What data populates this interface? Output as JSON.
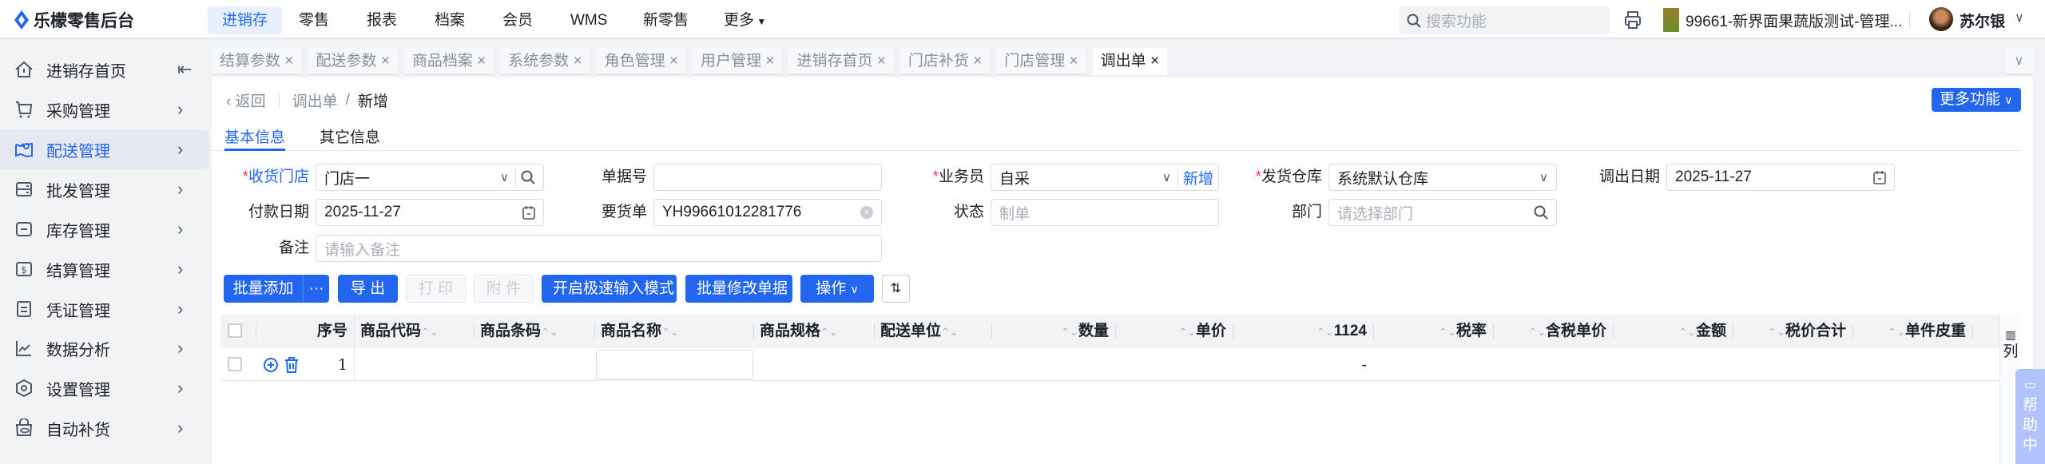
{
  "app": {
    "title": "乐檬零售后台"
  },
  "topnav": {
    "items": [
      "进销存",
      "零售",
      "报表",
      "档案",
      "会员",
      "WMS",
      "新零售",
      "更多"
    ],
    "active": "进销存"
  },
  "header": {
    "search_placeholder": "搜索功能",
    "store": "99661-新界面果蔬版测试-管理...",
    "user": "苏尔银"
  },
  "sidebar": {
    "items": [
      {
        "label": "进销存首页",
        "icon": "home-icon"
      },
      {
        "label": "采购管理",
        "icon": "cart-icon"
      },
      {
        "label": "配送管理",
        "icon": "map-icon"
      },
      {
        "label": "批发管理",
        "icon": "server-icon"
      },
      {
        "label": "库存管理",
        "icon": "inbox-icon"
      },
      {
        "label": "结算管理",
        "icon": "dollar-icon"
      },
      {
        "label": "凭证管理",
        "icon": "document-icon"
      },
      {
        "label": "数据分析",
        "icon": "chart-icon"
      },
      {
        "label": "设置管理",
        "icon": "settings-icon"
      },
      {
        "label": "自动补货",
        "icon": "bag-icon"
      }
    ]
  },
  "tabs": [
    "结算参数",
    "配送参数",
    "商品档案",
    "系统参数",
    "角色管理",
    "用户管理",
    "进销存首页",
    "门店补货",
    "门店管理",
    "调出单"
  ],
  "breadcrumb": {
    "back": "返回",
    "parent": "调出单",
    "sep": "/",
    "current": "新增"
  },
  "more_functions": "更多功能",
  "subtabs": [
    "基本信息",
    "其它信息"
  ],
  "form": {
    "receive_store": {
      "label": "收货门店",
      "value": "门店一"
    },
    "doc_no": {
      "label": "单据号",
      "value": ""
    },
    "salesman": {
      "label": "业务员",
      "value": "自采",
      "link": "新增"
    },
    "warehouse": {
      "label": "发货仓库",
      "value": "系统默认仓库"
    },
    "out_date": {
      "label": "调出日期",
      "value": "2025-11-27"
    },
    "pay_date": {
      "label": "付款日期",
      "value": "2025-11-27"
    },
    "request_no": {
      "label": "要货单",
      "value": "YH99661012281776"
    },
    "status": {
      "label": "状态",
      "value": "制单"
    },
    "department": {
      "label": "部门",
      "placeholder": "请选择部门"
    },
    "remark": {
      "label": "备注",
      "placeholder": "请输入备注"
    }
  },
  "toolbar": {
    "batch_add": "批量添加",
    "more": "···",
    "export": "导 出",
    "print": "打 印",
    "attach": "附 件",
    "fast_input": "开启极速输入模式",
    "batch_edit": "批量修改单据",
    "ops": "操作"
  },
  "table": {
    "columns": [
      "序号",
      "商品代码",
      "商品条码",
      "商品名称",
      "商品规格",
      "配送单位",
      "数量",
      "单价",
      "1124",
      "税率",
      "含税单价",
      "金额",
      "税价合计",
      "单件皮重"
    ],
    "rows": [
      {
        "seq": "1",
        "col_1124": "-"
      }
    ],
    "column_settings": "列"
  },
  "help": "帮助中"
}
